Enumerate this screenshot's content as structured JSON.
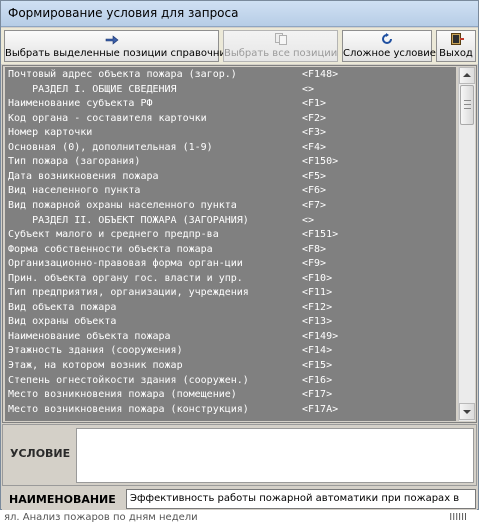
{
  "window": {
    "title": "Формирование условия для запроса"
  },
  "toolbar": {
    "buttons": [
      {
        "label": "Выбрать выделенные позиции справочника",
        "icon": "hand-pointer-icon",
        "enabled": true
      },
      {
        "label": "Выбрать все позиции",
        "icon": "copy-icon",
        "enabled": false
      },
      {
        "label": "Сложное условие",
        "icon": "refresh-arrow-icon",
        "enabled": true
      },
      {
        "label": "Выход",
        "icon": "exit-door-icon",
        "enabled": true
      }
    ]
  },
  "list": {
    "items": [
      {
        "text": "Почтовый адрес объекта пожара (загор.)",
        "code": "<F148>"
      },
      {
        "text": "    РАЗДЕЛ I. ОБЩИЕ СВЕДЕНИЯ",
        "code": "<>"
      },
      {
        "text": "Наименование субъекта РФ",
        "code": "<F1>"
      },
      {
        "text": "Код органа - составителя карточки",
        "code": "<F2>"
      },
      {
        "text": "Номер карточки",
        "code": "<F3>"
      },
      {
        "text": "Основная (0), дополнительная (1-9)",
        "code": "<F4>"
      },
      {
        "text": "Тип пожара (загорания)",
        "code": "<F150>"
      },
      {
        "text": "Дата возникновения пожара",
        "code": "<F5>"
      },
      {
        "text": "Вид населенного пункта",
        "code": "<F6>"
      },
      {
        "text": "Вид пожарной охраны населенного пункта",
        "code": "<F7>"
      },
      {
        "text": "    РАЗДЕЛ II. ОБЪЕКТ ПОЖАРА (ЗАГОРАНИЯ)",
        "code": "<>"
      },
      {
        "text": "Субъект малого и среднего предпр-ва",
        "code": "<F151>"
      },
      {
        "text": "Форма собственности объекта пожара",
        "code": "<F8>"
      },
      {
        "text": "Организационно-правовая форма орган-ции",
        "code": "<F9>"
      },
      {
        "text": "Прин. объекта органу гос. власти и упр.",
        "code": "<F10>"
      },
      {
        "text": "Тип предприятия, организации, учреждения",
        "code": "<F11>"
      },
      {
        "text": "Вид объекта пожара",
        "code": "<F12>"
      },
      {
        "text": "Вид охраны объекта",
        "code": "<F13>"
      },
      {
        "text": "Наименование объекта пожара",
        "code": "<F149>"
      },
      {
        "text": "Этажность здания (сооружения)",
        "code": "<F14>"
      },
      {
        "text": "Этаж, на котором возник пожар",
        "code": "<F15>"
      },
      {
        "text": "Степень огнестойкости здания (сооружен.)",
        "code": "<F16>"
      },
      {
        "text": "Место возникновения пожара (помещение)",
        "code": "<F17>"
      },
      {
        "text": "Место возникновения пожара (конструкция)",
        "code": "<F17A>"
      }
    ]
  },
  "condition": {
    "label": "УСЛОВИЕ",
    "value": ""
  },
  "name_field": {
    "label": "НАИМЕНОВАНИЕ",
    "value": "Эффективность работы пожарной автоматики при пожарах в"
  },
  "background": {
    "text": "ял. Анализ пожаров по дням недели",
    "right_text": "IIIIII"
  },
  "colors": {
    "list_bg": "#808080",
    "list_text": "#ffffff",
    "window_bg": "#d4d0c8",
    "titlebar": "#c4d7ee"
  }
}
